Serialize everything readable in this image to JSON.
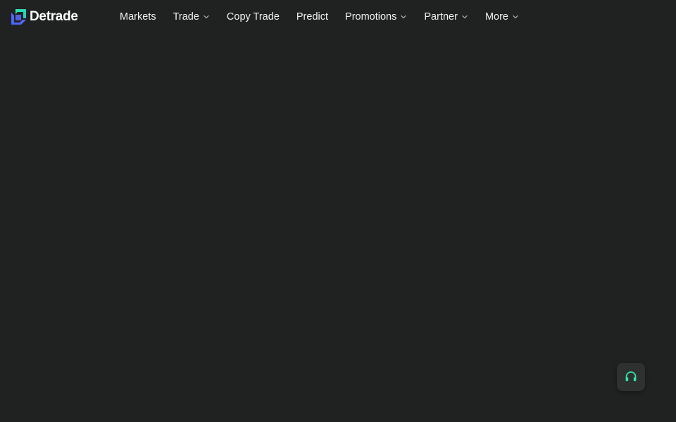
{
  "brand": {
    "name": "Detrade",
    "logo_icon": "detrade-logo-icon",
    "logo_colors": [
      "#2ee6a8",
      "#7b5cff",
      "#3b6bff"
    ]
  },
  "nav": {
    "items": [
      {
        "label": "Markets",
        "has_dropdown": false
      },
      {
        "label": "Trade",
        "has_dropdown": true
      },
      {
        "label": "Copy Trade",
        "has_dropdown": false
      },
      {
        "label": "Predict",
        "has_dropdown": false
      },
      {
        "label": "Promotions",
        "has_dropdown": true
      },
      {
        "label": "Partner",
        "has_dropdown": true
      },
      {
        "label": "More",
        "has_dropdown": true
      }
    ],
    "dropdown_icon": "chevron-down-icon"
  },
  "support": {
    "icon": "headset-icon",
    "color": "#2ee6a8"
  },
  "theme": {
    "background": "#202121",
    "text": "#f2f2f2"
  }
}
